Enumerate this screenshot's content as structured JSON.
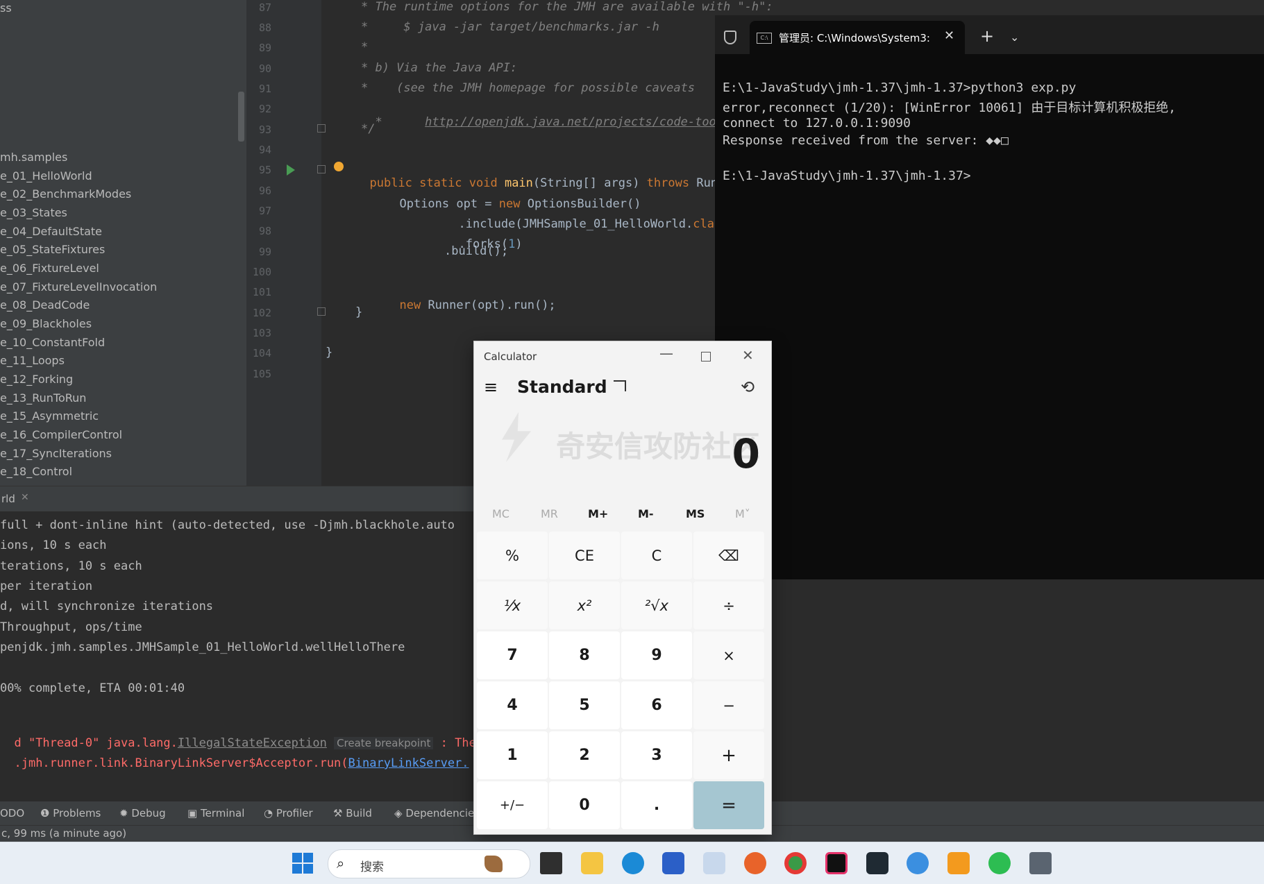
{
  "project_tree": {
    "header": "ss",
    "items": [
      "mh.samples",
      "e_01_HelloWorld",
      "e_02_BenchmarkModes",
      "e_03_States",
      "e_04_DefaultState",
      "e_05_StateFixtures",
      "e_06_FixtureLevel",
      "e_07_FixtureLevelInvocation",
      "e_08_DeadCode",
      "e_09_Blackholes",
      "e_10_ConstantFold",
      "e_11_Loops",
      "e_12_Forking",
      "e_13_RunToRun",
      "e_15_Asymmetric",
      "e_16_CompilerControl",
      "e_17_SyncIterations",
      "e_18_Control"
    ]
  },
  "editor": {
    "line_numbers": [
      "87",
      "88",
      "89",
      "90",
      "91",
      "92",
      "93",
      "94",
      "95",
      "96",
      "97",
      "98",
      "99",
      "100",
      "101",
      "102",
      "103",
      "104",
      "105"
    ],
    "lines": {
      "l87": "* The runtime options for the JMH are available with \"-h\":",
      "l88": "*     $ java -jar target/benchmarks.jar -h",
      "l89": "*",
      "l90": "* b) Via the Java API:",
      "l91": "*    (see the JMH homepage for possible caveats",
      "l92_star": "*",
      "l92_link": "http://openjdk.java.net/projects/code-too",
      "l93": "*/",
      "l95_kw": "public static void ",
      "l95_fn": "main",
      "l95_args": "(String[] args) ",
      "l95_throws": "throws ",
      "l95_rest": "Run",
      "l96_a": "Options opt = ",
      "l96_new": "new ",
      "l96_b": "OptionsBuilder()",
      "l97_a": ".include(JMHSample_01_HelloWorld.",
      "l97_b": "clas",
      "l98_a": ".forks(",
      "l98_num": "1",
      "l98_b": ")",
      "l99": ".build();",
      "l101_new": "new ",
      "l101_b": "Runner(opt).run();",
      "l102": "}",
      "l104": "}"
    }
  },
  "run_tab": {
    "label": "rld"
  },
  "console": {
    "lines": [
      "full + dont-inline hint (auto-detected, use -Djmh.blackhole.auto",
      "ions, 10 s each",
      "terations, 10 s each",
      "per iteration",
      "d, will synchronize iterations",
      "Throughput, ops/time",
      "penjdk.jmh.samples.JMHSample_01_HelloWorld.wellHelloThere",
      "00% complete, ETA 00:01:40"
    ],
    "err1_a": "d \"Thread-0\" java.lang.",
    "err1_link": "IllegalStateException",
    "err1_hint": "Create breakpoint",
    "err1_b": " : The",
    "err2_a": ".jmh.runner.link.BinaryLinkServer$Acceptor.run(",
    "err2_link": "BinaryLinkServer."
  },
  "bottom_tools": [
    {
      "label": "ODO",
      "icon": "todo-icon"
    },
    {
      "label": "Problems",
      "icon": "problems-icon"
    },
    {
      "label": "Debug",
      "icon": "bug-icon"
    },
    {
      "label": "Terminal",
      "icon": "terminal-icon"
    },
    {
      "label": "Profiler",
      "icon": "profiler-icon"
    },
    {
      "label": "Build",
      "icon": "hammer-icon"
    },
    {
      "label": "Dependencie",
      "icon": "layers-icon"
    }
  ],
  "status_bar": {
    "text": "c, 99 ms (a minute ago)"
  },
  "terminal": {
    "tab_title": "管理员: C:\\Windows\\System3:",
    "lines": [
      "E:\\1-JavaStudy\\jmh-1.37\\jmh-1.37>python3 exp.py",
      "error,reconnect (1/20): [WinError 10061] 由于目标计算机积极拒绝,",
      "connect to 127.0.0.1:9090",
      "Response received from the server: ◆◆□",
      "",
      "E:\\1-JavaStudy\\jmh-1.37\\jmh-1.37>"
    ]
  },
  "calculator": {
    "title": "Calculator",
    "mode": "Standard",
    "display": "0",
    "watermark": "奇安信攻防社区",
    "memory": [
      "MC",
      "MR",
      "M+",
      "M-",
      "MS",
      "M˅"
    ],
    "keys": [
      [
        "%",
        "CE",
        "C",
        "⌫"
      ],
      [
        "⅟x",
        "x²",
        "²√x",
        "÷"
      ],
      [
        "7",
        "8",
        "9",
        "×"
      ],
      [
        "4",
        "5",
        "6",
        "−"
      ],
      [
        "1",
        "2",
        "3",
        "+"
      ],
      [
        "+/−",
        "0",
        ".",
        "="
      ]
    ]
  },
  "taskbar": {
    "search_placeholder": "搜索"
  }
}
